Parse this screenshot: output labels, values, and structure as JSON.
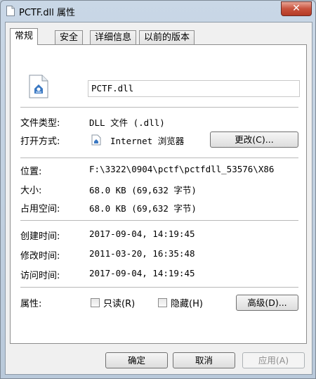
{
  "window": {
    "title": "PCTF.dll 属性",
    "close_glyph": "✕"
  },
  "tabs": [
    {
      "label": "常规",
      "active": true
    },
    {
      "label": "安全",
      "active": false
    },
    {
      "label": "详细信息",
      "active": false
    },
    {
      "label": "以前的版本",
      "active": false
    }
  ],
  "general": {
    "file_name": "PCTF.dll",
    "file_type_label": "文件类型:",
    "file_type_value": "DLL 文件 (.dll)",
    "open_with_label": "打开方式:",
    "open_with_value": "Internet 浏览器",
    "change_button": "更改(C)...",
    "location_label": "位置:",
    "location_value": "F:\\3322\\0904\\pctf\\pctfdll_53576\\X86",
    "size_label": "大小:",
    "size_value": "68.0 KB (69,632 字节)",
    "size_on_disk_label": "占用空间:",
    "size_on_disk_value": "68.0 KB (69,632 字节)",
    "created_label": "创建时间:",
    "created_value": "2017-09-04, 14:19:45",
    "modified_label": "修改时间:",
    "modified_value": "2011-03-20, 16:35:48",
    "accessed_label": "访问时间:",
    "accessed_value": "2017-09-04, 14:19:45",
    "attributes_label": "属性:",
    "readonly_label": "只读(R)",
    "readonly_checked": false,
    "hidden_label": "隐藏(H)",
    "hidden_checked": false,
    "advanced_button": "高级(D)..."
  },
  "footer": {
    "ok_button": "确定",
    "cancel_button": "取消",
    "apply_button": "应用(A)"
  }
}
